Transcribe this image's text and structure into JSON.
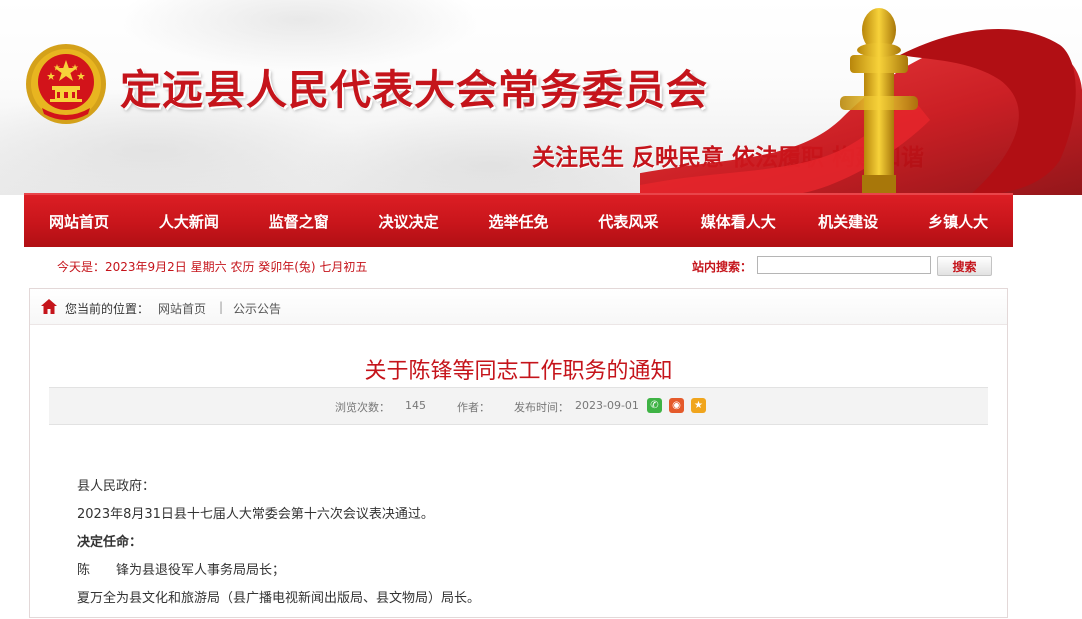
{
  "header": {
    "site_title": "定远县人民代表大会常务委员会",
    "slogan": "关注民生 反映民意 依法履职 构建和谐"
  },
  "nav": {
    "items": [
      "网站首页",
      "人大新闻",
      "监督之窗",
      "决议决定",
      "选举任免",
      "代表风采",
      "媒体看人大",
      "机关建设",
      "乡镇人大"
    ]
  },
  "infobar": {
    "today": "今天是：2023年9月2日 星期六 农历 癸卯年(兔) 七月初五",
    "search_label": "站内搜索：",
    "search_value": "",
    "search_button": "搜索"
  },
  "breadcrumb": {
    "lead": "您当前的位置：",
    "items": [
      "网站首页",
      "公示公告"
    ],
    "separator": "|"
  },
  "article": {
    "title": "关于陈锋等同志工作职务的通知",
    "views_label": "浏览次数：",
    "views": "145",
    "author_label": "作者：",
    "author": "",
    "published_label": "发布时间：",
    "published": "2023-09-01",
    "share_icons": [
      "wechat-icon",
      "weibo-icon",
      "favorite-icon"
    ],
    "paragraphs": [
      "县人民政府：",
      "2023年8月31日县十七届人大常委会第十六次会议表决通过。",
      "决定任命：",
      "陈　　锋为县退役军人事务局局长；",
      "夏万全为县文化和旅游局（县广播电视新闻出版局、县文物局）局长。"
    ]
  },
  "colors": {
    "brand_red": "#c5141b",
    "nav_red": "#c8151b",
    "wechat": "#3fb345",
    "weibo": "#e55a2b",
    "favorite": "#f0a51d"
  }
}
